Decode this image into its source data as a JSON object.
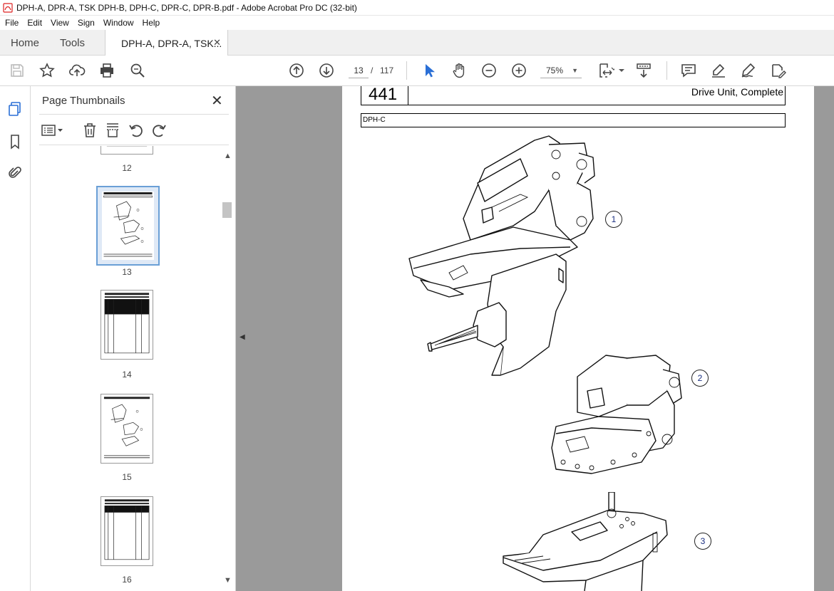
{
  "window": {
    "title": "DPH-A, DPR-A, TSK DPH-B, DPH-C, DPR-C, DPR-B.pdf - Adobe Acrobat Pro DC (32-bit)"
  },
  "menu": [
    "File",
    "Edit",
    "View",
    "Sign",
    "Window",
    "Help"
  ],
  "tabs": {
    "home": "Home",
    "tools": "Tools",
    "document": "DPH-A, DPR-A, TSK...",
    "close_glyph": "✕"
  },
  "toolbar": {
    "current_page": "13",
    "page_separator": "/",
    "total_pages": "117",
    "zoom": "75%",
    "icons": [
      "save-icon",
      "star-icon",
      "upload-icon",
      "print-icon",
      "search-icon",
      "page-up-icon",
      "page-down-icon",
      "select-arrow-icon",
      "hand-icon",
      "zoom-out-icon",
      "zoom-in-icon",
      "fit-page-icon",
      "scroll-mode-icon",
      "comment-icon",
      "highlight-icon",
      "sign-icon",
      "more-tools-icon"
    ]
  },
  "left_rail": {
    "icons": [
      "page-thumbnails-icon",
      "bookmark-icon",
      "attachment-icon"
    ]
  },
  "thumbnail_panel": {
    "title": "Page Thumbnails",
    "close_glyph": "✕",
    "thumbnails": [
      {
        "label": "12",
        "active": false
      },
      {
        "label": "13",
        "active": true
      },
      {
        "label": "14",
        "active": false
      },
      {
        "label": "15",
        "active": false
      },
      {
        "label": "16",
        "active": false
      }
    ]
  },
  "document": {
    "page_number": "441",
    "heading": "Drive Unit, Complete",
    "variant": "DPH-C",
    "callouts": [
      "1",
      "2",
      "3"
    ]
  },
  "colors": {
    "accent_blue": "#2a6fd6",
    "doc_background": "#9a9a9a",
    "active_thumb_border": "#6a9fd6"
  }
}
